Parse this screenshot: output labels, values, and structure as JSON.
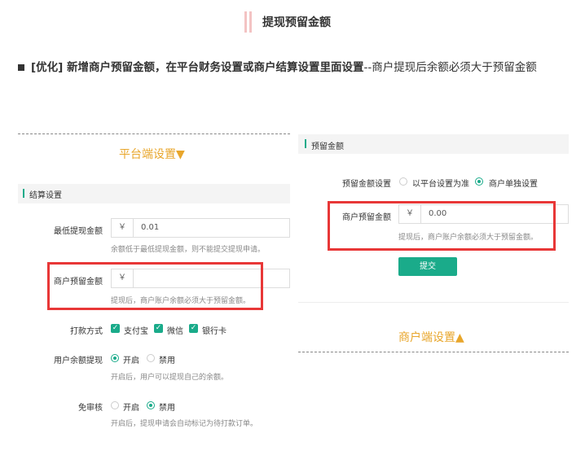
{
  "header": {
    "title": "提现预留金额"
  },
  "note": {
    "prefix": "[优化] 新增商户预留金额，在平台财务设置或商户结算设置里面设置",
    "suffix": "--商户提现后余额必须大于预留金额"
  },
  "left": {
    "caption": "平台端设置▼",
    "section_title": "结算设置",
    "min_withdraw": {
      "label": "最低提现金额",
      "currency": "￥",
      "value": "0.01",
      "hint": "余额低于最低提现金额，则不能提交提现申请。"
    },
    "reserve": {
      "label": "商户预留金额",
      "currency": "￥",
      "value": "",
      "hint": "提现后，商户账户余额必须大于预留金额。"
    },
    "pay_method": {
      "label": "打款方式",
      "options": [
        "支付宝",
        "微信",
        "银行卡"
      ]
    },
    "user_withdraw": {
      "label": "用户余额提现",
      "on": "开启",
      "off": "禁用",
      "hint": "开启后，用户可以提现自己的余额。"
    },
    "no_review": {
      "label": "免审核",
      "on": "开启",
      "off": "禁用",
      "hint": "开启后，提现申请会自动标记为待打款订单。"
    }
  },
  "right": {
    "section_title": "预留金额",
    "setting": {
      "label": "预留金额设置",
      "opt1": "以平台设置为准",
      "opt2": "商户单独设置"
    },
    "reserve": {
      "label": "商户预留金额",
      "currency": "￥",
      "value": "0.00",
      "hint": "提现后，商户账户余额必须大于预留金额。"
    },
    "submit": "提交",
    "caption": "商户端设置▲"
  },
  "colors": {
    "accent": "#1aab8a",
    "highlight": "#e83737",
    "caption": "#e8a62b"
  }
}
